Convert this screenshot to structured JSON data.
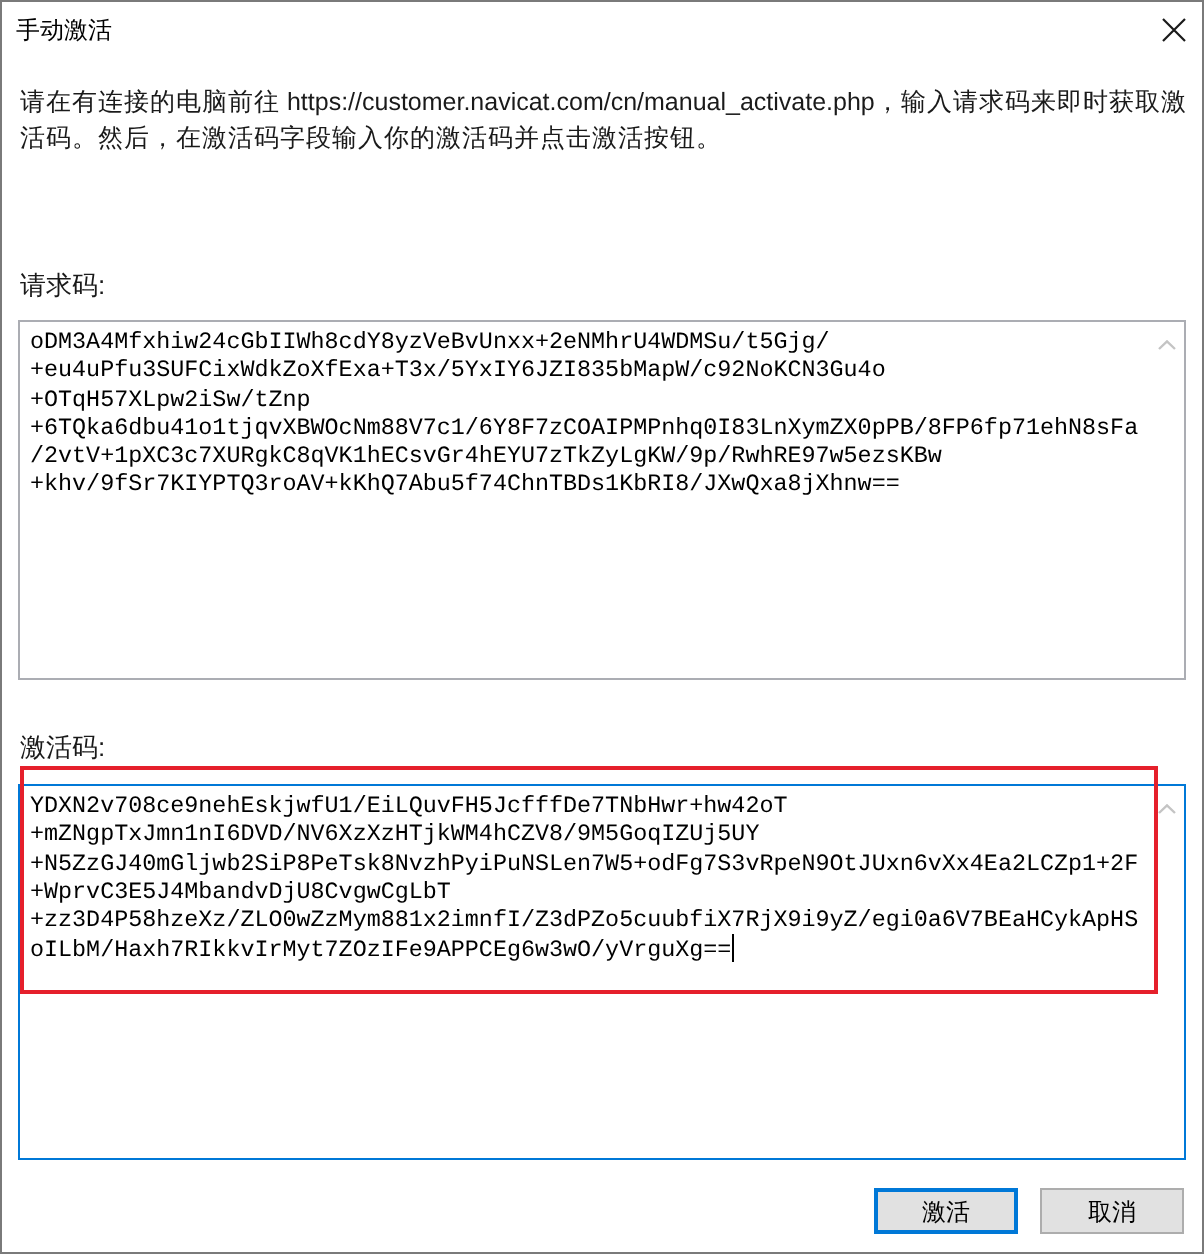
{
  "window": {
    "title": "手动激活"
  },
  "instructions": "请在有连接的电脑前往 https://customer.navicat.com/cn/manual_activate.php，输入请求码来即时获取激活码。然后，在激活码字段输入你的激活码并点击激活按钮。",
  "request_code": {
    "label": "请求码:",
    "focused": false,
    "lines": [
      "oDM3A4Mfxhiw24cGbIIWh8cdY8yzVeBvUnxx+2eNMhrU4WDMSu/t5Gjg/",
      "+eu4uPfu3SUFCixWdkZoXfExa+T3x/5YxIY6JZI835bMapW/c92NoKCN3Gu4o",
      "+OTqH57XLpw2iSw/tZnp",
      "+6TQka6dbu41o1tjqvXBWOcNm88V7c1/6Y8F7zCOAIPMPnhq0I83LnXymZX0pPB/8FP6fp71ehN8sFa",
      "/2vtV+1pXC3c7XURgkC8qVK1hECsvGr4hEYU7zTkZyLgKW/9p/RwhRE97w5ezsKBw",
      "+khv/9fSr7KIYPTQ3roAV+kKhQ7Abu5f74ChnTBDs1KbRI8/JXwQxa8jXhnw=="
    ]
  },
  "activation_code": {
    "label": "激活码:",
    "focused": true,
    "highlighted": true,
    "lines": [
      "YDXN2v708ce9nehEskjwfU1/EiLQuvFH5JcfffDe7TNbHwr+hw42oT",
      "+mZNgpTxJmn1nI6DVD/NV6XzXzHTjkWM4hCZV8/9M5GoqIZUj5UY",
      "+N5ZzGJ40mGljwb2SiP8PeTsk8NvzhPyiPuNSLen7W5+odFg7S3vRpeN9OtJUxn6vXx4Ea2LCZp1+2F",
      "+WprvC3E5J4MbandvDjU8CvgwCgLbT",
      "+zz3D4P58hzeXz/ZLO0wZzMym881x2imnfI/Z3dPZo5cuubfiX7RjX9i9yZ/egi0a6V7BEaHCykApHS",
      "oILbM/Haxh7RIkkvIrMyt7ZOzIFe9APPCEg6w3wO/yVrguXg=="
    ]
  },
  "buttons": [
    {
      "label": "激活",
      "default": true
    },
    {
      "label": "取消",
      "default": false
    }
  ]
}
